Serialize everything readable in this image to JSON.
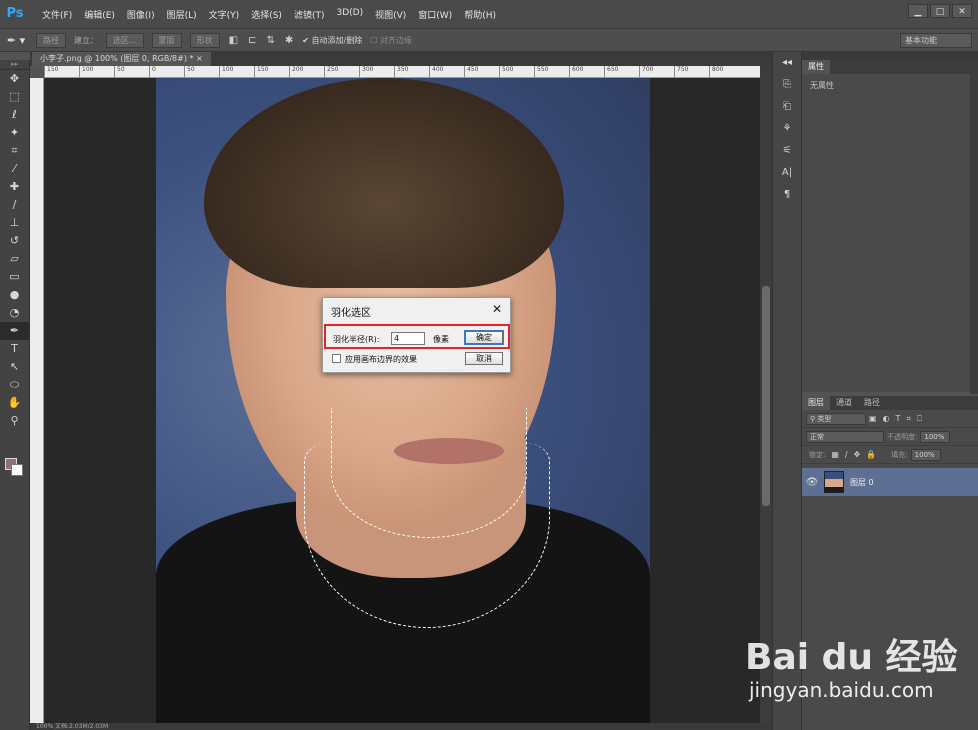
{
  "app": {
    "logo": "Ps"
  },
  "menu": [
    "文件(F)",
    "编辑(E)",
    "图像(I)",
    "图层(L)",
    "文字(Y)",
    "选择(S)",
    "滤镜(T)",
    "3D(D)",
    "视图(V)",
    "窗口(W)",
    "帮助(H)"
  ],
  "window_controls": [
    "▁",
    "□",
    "✕"
  ],
  "options_bar": {
    "tool_icon": "pen-tool-icon",
    "path_mode": "路径",
    "make_label": "建立：",
    "selection_btn": "选区...",
    "mask_btn": "蒙版",
    "shape_btn": "形状",
    "auto_add_delete": "自动添加/删除",
    "align_edges": "对齐边缘",
    "workspace": "基本功能"
  },
  "document": {
    "tab": "小李子.png @ 100% (图层 0, RGB/8#) *",
    "ruler_ticks": [
      "150",
      "100",
      "50",
      "0",
      "50",
      "100",
      "150",
      "200",
      "250",
      "300",
      "350",
      "400",
      "450",
      "500",
      "550",
      "600",
      "650",
      "700",
      "750",
      "800"
    ],
    "status": "100%    文档:2.03M/2.03M"
  },
  "tools": [
    "move-tool-icon",
    "marquee-tool-icon",
    "lasso-tool-icon",
    "magic-wand-tool-icon",
    "crop-tool-icon",
    "eyedropper-tool-icon",
    "healing-brush-tool-icon",
    "brush-tool-icon",
    "clone-stamp-tool-icon",
    "history-brush-tool-icon",
    "eraser-tool-icon",
    "gradient-tool-icon",
    "blur-tool-icon",
    "dodge-tool-icon",
    "pen-tool-icon",
    "type-tool-icon",
    "path-selection-tool-icon",
    "ellipse-tool-icon",
    "hand-tool-icon",
    "zoom-tool-icon"
  ],
  "dialog": {
    "title": "羽化选区",
    "close": "✕",
    "radius_label": "羽化半径(R):",
    "radius_value": "4",
    "unit": "像素",
    "ok": "确定",
    "cancel": "取消",
    "canvas_bounds_label": "应用画布边界的效果",
    "highlight_color": "#e0252c"
  },
  "properties_panel": {
    "tab": "属性",
    "empty_text": "无属性"
  },
  "layers_panel": {
    "tabs": [
      "图层",
      "通道",
      "路径"
    ],
    "filter_kind": "类型",
    "blend_mode": "正常",
    "opacity_label": "不透明度:",
    "opacity_value": "100%",
    "lock_label": "锁定:",
    "fill_label": "填充:",
    "fill_value": "100%",
    "layer_name": "图层 0"
  },
  "watermark": {
    "logo": "Bai du 经验",
    "url": "jingyan.baidu.com"
  },
  "colors": {
    "foreground": "#8f7272",
    "background": "#ffffff",
    "layer_selected": "#5d7093"
  }
}
